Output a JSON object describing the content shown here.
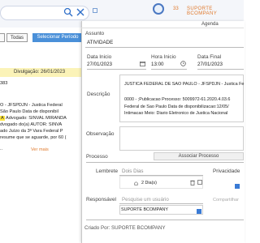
{
  "header": {
    "count": "33",
    "company": "SUPORTE BCOMPANY"
  },
  "filters": {
    "todas_label": "Todas",
    "periodo_label": "Selecionar Período"
  },
  "card": {
    "date_label": "Divulgação: 26/01/2023",
    "lines": [
      "383",
      "O - JFSPDJN - Justica Federal",
      "São Paulo Data de disponibil",
      "Advogado: SINVAL MIRANDA",
      "dvogado do(a) AUTOR: SINVA",
      "ado Juízo da 3ª Vara Federal P",
      "resume que se aguarde, por 60 (",
      ".."
    ],
    "highlight": "A",
    "ver_mais": "Ver mais"
  },
  "modal": {
    "title": "Agenda",
    "assunto_label": "Assunto",
    "assunto_value": "ATIVIDADE",
    "data_inicio_label": "Data Inicio",
    "data_inicio_value": "27/01/2023",
    "hora_inicio_label": "Hora Inicio",
    "hora_inicio_value": "13:00",
    "data_final_label": "Data Final",
    "data_final_value": "27/01/2023",
    "descricao_label": "Descrição",
    "descricao_lines": [
      "JUSTICA FEDERAL DE SAO PAULO - JFSPDJN - Justica Fe",
      "",
      "0000 - ;Publicacao Processo: 5009972-61.2020.4.03.6",
      "Federal de Sao Paulo Data de disponibilizacao:12/05/",
      "Intimacao Meio: Diario Eletronico de Justica Nacional"
    ],
    "observacao_label": "Observação",
    "processo_label": "Processo",
    "associar_label": "Associar Processo",
    "lembrete_label": "Lembrete",
    "lembrete_value": "Dois Dias",
    "lembrete_entry": "2 Dia(s)",
    "privacidade_label": "Privacidade",
    "responsavel_label": "Responsável",
    "responsavel_placeholder": "Pesquise um usuário",
    "compartilhar_label": "Compartilhar",
    "responsavel_entry": "SUPORTE BCOMPANY",
    "criado_por": "Criado Por: SUPORTE BCOMPANY"
  }
}
